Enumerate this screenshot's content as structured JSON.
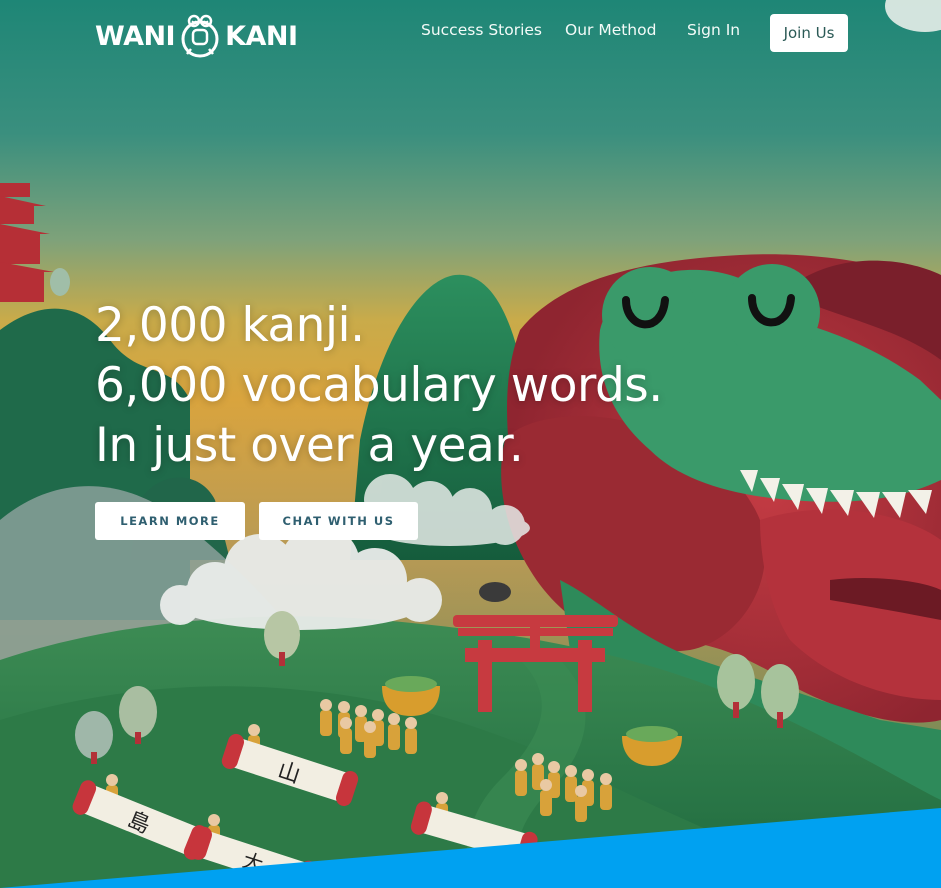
{
  "brand": {
    "left": "WANI",
    "right": "KANI",
    "mascot_icon": "crab-mascot-icon"
  },
  "nav": {
    "links": [
      "Success Stories",
      "Our Method",
      "Sign In"
    ],
    "join_label": "Join Us"
  },
  "hero": {
    "lines": [
      "2,000 kanji.",
      "6,000 vocabulary words.",
      "In just over a year."
    ],
    "learn_more": "LEARN MORE",
    "chat": "CHAT WITH US"
  },
  "scene": {
    "scroll_kanji": [
      "山",
      "島",
      "大"
    ],
    "colors": {
      "sky_top": "#1d8676",
      "sky_glow": "#e2a93a",
      "hill": "#2f7a49",
      "crab_red": "#b2323b",
      "crab_green": "#3a9a6a",
      "torii": "#c73a40",
      "accent_bar": "#00a1f1"
    }
  }
}
